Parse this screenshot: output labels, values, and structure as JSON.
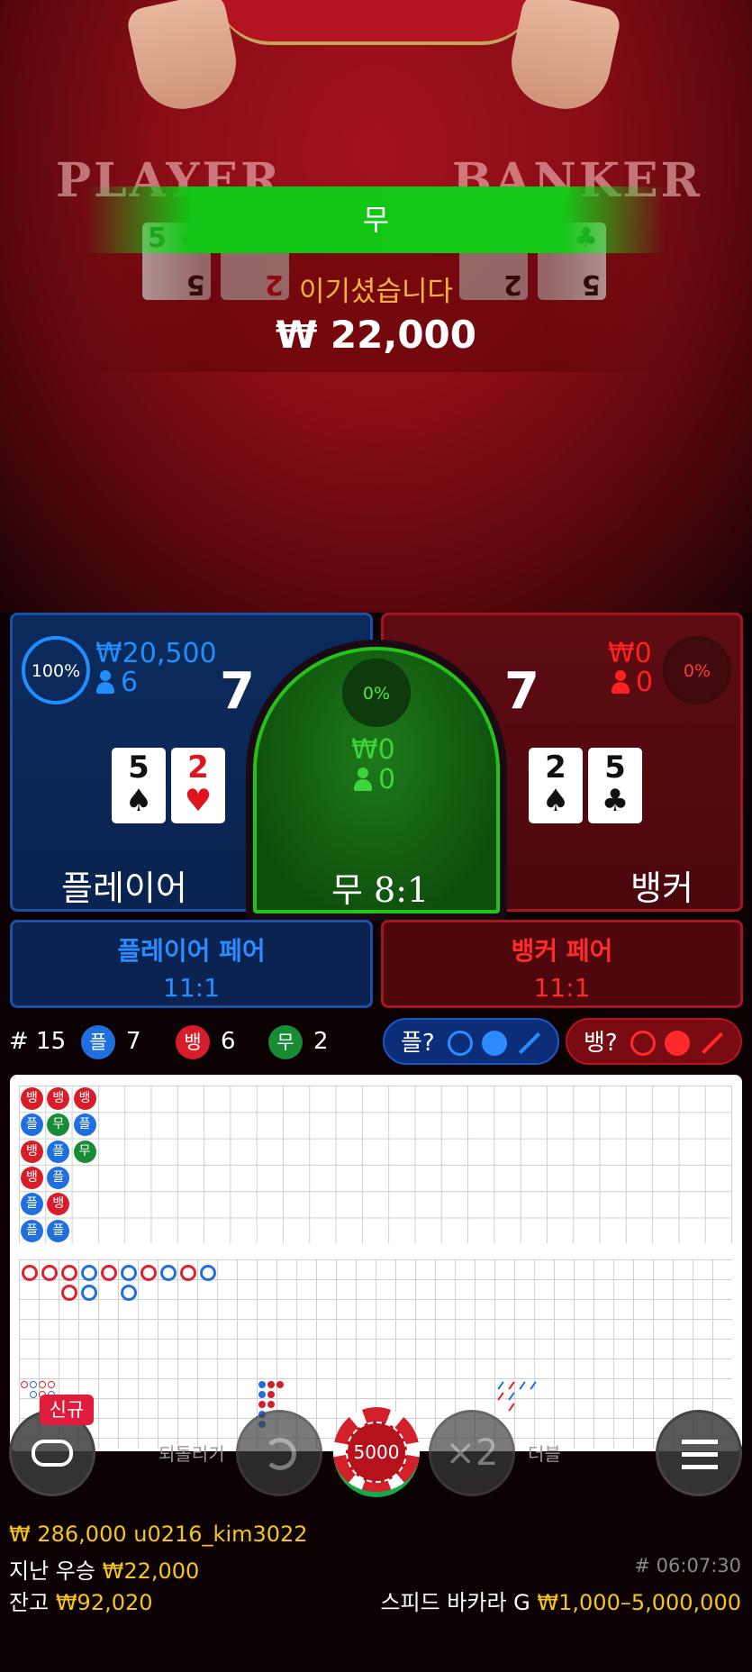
{
  "video": {
    "player_word": "PLAYER",
    "banker_word": "BANKER",
    "result_banner": "무",
    "won_text": "이기셨습니다",
    "won_amount": "₩ 22,000",
    "felt_cards": [
      {
        "rank": "5",
        "suit": "♠",
        "color": "#1f7a2a"
      },
      {
        "rank": "2",
        "suit": "♥",
        "color": "#1f7a2a"
      },
      {
        "rank": "2",
        "suit": "♠",
        "color": "#1f7a2a"
      },
      {
        "rank": "5",
        "suit": "♣",
        "color": "#1f7a2a"
      }
    ]
  },
  "player": {
    "percent": "100%",
    "amount": "₩20,500",
    "players": "6",
    "score": "7",
    "cards": [
      {
        "rank": "5",
        "suit": "♠",
        "red": false
      },
      {
        "rank": "2",
        "suit": "♥",
        "red": true
      }
    ],
    "label": "플레이어",
    "color": "#1f8fff"
  },
  "tie": {
    "percent": "0%",
    "amount": "₩0",
    "players": "0",
    "label": "무 8:1",
    "color": "#3dd63a"
  },
  "banker": {
    "percent": "0%",
    "amount": "₩0",
    "players": "0",
    "score": "7",
    "cards": [
      {
        "rank": "2",
        "suit": "♠",
        "red": false
      },
      {
        "rank": "5",
        "suit": "♣",
        "red": false
      }
    ],
    "label": "뱅커",
    "color": "#ff2020"
  },
  "pairs": {
    "player_pair": {
      "name": "플레이어 페어",
      "odds": "11:1"
    },
    "banker_pair": {
      "name": "뱅커 페어",
      "odds": "11:1"
    }
  },
  "stats": {
    "round": "# 15",
    "player_label": "플",
    "player_count": "7",
    "banker_label": "뱅",
    "banker_count": "6",
    "tie_label": "무",
    "tie_count": "2",
    "player_predict": "플?",
    "banker_predict": "뱅?"
  },
  "bead_road": [
    [
      "뱅",
      "플",
      "뱅",
      "뱅",
      "플",
      "플"
    ],
    [
      "뱅",
      "무",
      "플",
      "플",
      "뱅",
      "플"
    ],
    [
      "뱅",
      "플",
      "무"
    ]
  ],
  "controls": {
    "new_badge": "신규",
    "undo_label": "되돌리기",
    "double_label": "더블",
    "chip_value": "5000",
    "double_icon": "×2"
  },
  "footer": {
    "total_bet": "₩ 286,000",
    "username": "u0216_kim3022",
    "last_win_label": "지난 우승",
    "last_win_amount": "₩22,000",
    "balance_label": "잔고",
    "balance_amount": "₩92,020",
    "game_id": "# 06:07:30",
    "game_name": "스피드 바카라 G",
    "limits": "₩1,000–5,000,000"
  }
}
